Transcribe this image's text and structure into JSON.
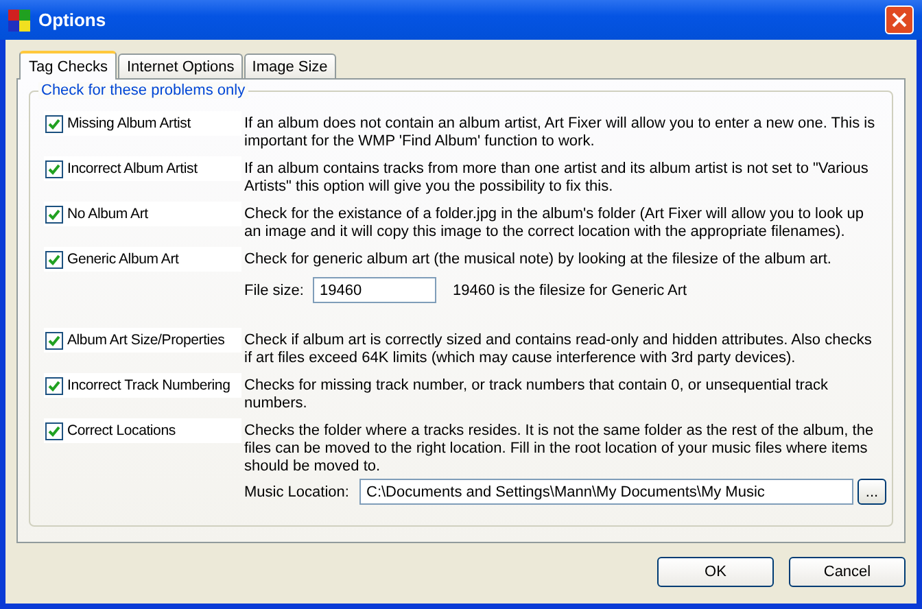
{
  "window": {
    "title": "Options"
  },
  "tabs": [
    {
      "label": "Tag Checks",
      "selected": true
    },
    {
      "label": "Internet Options",
      "selected": false
    },
    {
      "label": "Image Size",
      "selected": false
    }
  ],
  "group": {
    "title": "Check for these problems only"
  },
  "checks": [
    {
      "label": "Missing Album Artist",
      "checked": true,
      "description": "If an album does not contain an album artist, Art Fixer will allow you to enter a new one. This is important for the WMP 'Find Album' function to work."
    },
    {
      "label": "Incorrect Album Artist",
      "checked": true,
      "description": "If an album contains tracks from more than one artist and its album artist is not set to \"Various Artists\" this option will give you the possibility to fix this."
    },
    {
      "label": "No Album Art",
      "checked": true,
      "description": "Check for the existance of a folder.jpg in the album's folder (Art Fixer will allow you to look up an image and it will copy this image to the correct location with the appropriate filenames)."
    },
    {
      "label": "Generic Album Art",
      "checked": true,
      "description": "Check for generic album art (the musical note) by looking at the filesize of the album art.",
      "extra": {
        "kind": "filesize",
        "label": "File size:",
        "value": "19460",
        "note": "19460 is the filesize for Generic Art"
      }
    },
    {
      "label": "Album Art Size/Properties",
      "checked": true,
      "description": "Check if album art is correctly sized and contains read-only and hidden attributes. Also checks if art files exceed 64K limits (which may cause interference with 3rd party devices)."
    },
    {
      "label": "Incorrect Track Numbering",
      "checked": true,
      "description": "Checks for missing track number, or track numbers that contain 0, or unsequential track numbers."
    },
    {
      "label": "Correct Locations",
      "checked": true,
      "description": "Checks the folder where a tracks resides. It is not the same folder as the rest of the album, the files can be moved to the right location. Fill in the root location of your music files where items should be moved to.",
      "extra": {
        "kind": "location",
        "label": "Music Location:",
        "value": "C:\\Documents and Settings\\Mann\\My Documents\\My Music",
        "button": "..."
      }
    }
  ],
  "buttons": [
    "OK",
    "Cancel"
  ]
}
